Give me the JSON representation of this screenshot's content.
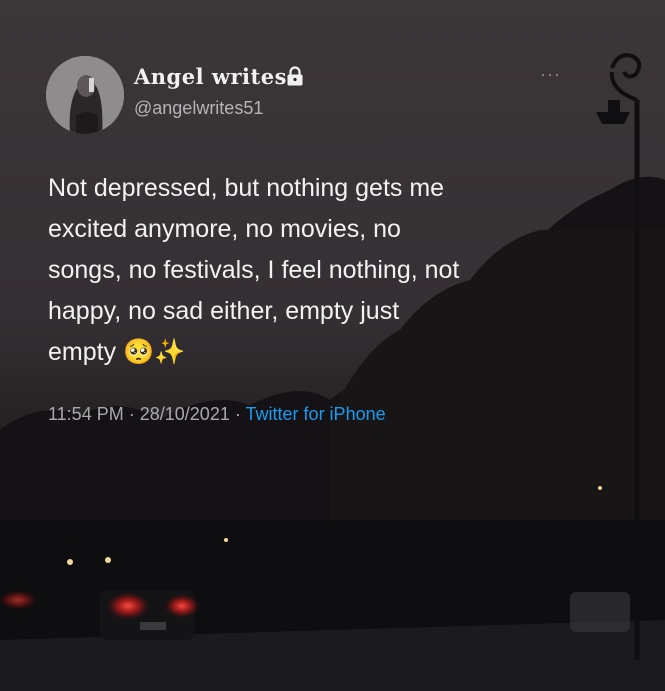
{
  "user": {
    "display_name": "Angel writes",
    "handle": "@angelwrites51",
    "lock_icon": "lock-icon"
  },
  "tweet": {
    "text": "Not depressed, but nothing gets me\nexcited anymore, no movies, no\nsongs, no festivals, I feel nothing, not\nhappy, no sad either, empty just\nempty",
    "emoji": "🥺",
    "sparkles": "✨"
  },
  "meta": {
    "time": "11:54 PM",
    "separator1": "·",
    "date": "28/10/2021",
    "separator2": "·",
    "source": "Twitter for iPhone"
  },
  "colors": {
    "link": "#1d9bf0",
    "text": "#f2f2f2",
    "muted": "#a9a9ab"
  }
}
